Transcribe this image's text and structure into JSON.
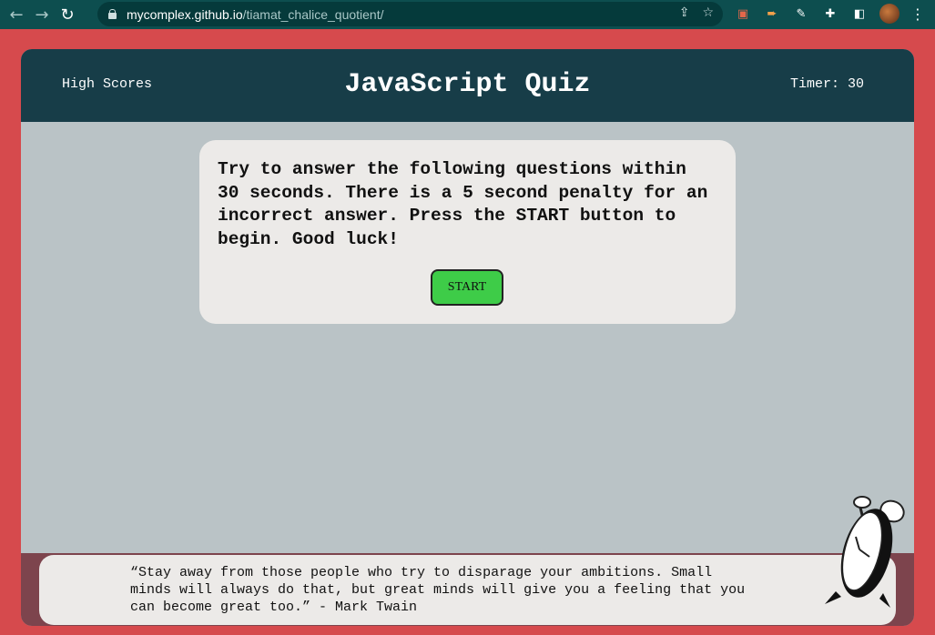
{
  "browser": {
    "url_host": "mycomplex.github.io",
    "url_path": "/tiamat_chalice_quotient/",
    "icons": [
      "back-icon",
      "forward-icon",
      "reload-icon",
      "lock-icon",
      "share-icon",
      "star-icon",
      "extensions-icon",
      "side-panel-icon",
      "avatar",
      "menu-icon"
    ]
  },
  "header": {
    "high_scores": "High Scores",
    "title": "JavaScript Quiz",
    "timer_label": "Timer:",
    "timer_value": "30"
  },
  "card": {
    "instructions": "Try to answer the following questions within 30 seconds. There is a 5 second penalty for an incorrect answer. Press the START button to begin. Good luck!",
    "start_label": "START"
  },
  "footer": {
    "quote": "“Stay away from those people who try to disparage your ambitions. Small minds will always do that, but great minds will give you a feeling that you can become great too.” - Mark Twain"
  },
  "colors": {
    "page_border": "#d64a4d",
    "header_bg": "#173d48",
    "body_bg": "#bac3c6",
    "card_bg": "#eceae8",
    "start_button": "#3ecc48",
    "footer_bg": "#7d444d"
  }
}
